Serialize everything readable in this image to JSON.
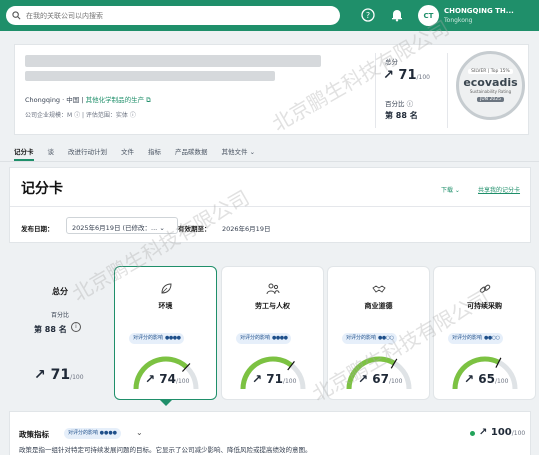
{
  "search": {
    "placeholder": "在我的关联公司以内搜索"
  },
  "account": {
    "initials": "CT",
    "name": "CHONGQING TH...",
    "sub": "Tongkong"
  },
  "profile": {
    "location": "Chongqing · 中国 |",
    "industry_link": "其他化学制品的生产",
    "meta": "公司企业规模：M ⓘ | 评估范围：实体 ⓘ",
    "total_label": "总分",
    "score": "71",
    "score_den": "/100",
    "percentile_label": "百分比",
    "rank": "第 88 名"
  },
  "medal": {
    "level": "SILVER | Top 15%",
    "brand": "ecovadis",
    "tagline": "Sustainability Rating",
    "date": "JUN 2025"
  },
  "tabs": [
    {
      "label": "记分卡"
    },
    {
      "label": "谈"
    },
    {
      "label": "改进行动计划"
    },
    {
      "label": "文件"
    },
    {
      "label": "指标"
    },
    {
      "label": "产品碳数据"
    },
    {
      "label": "其他文件 ⌄"
    }
  ],
  "scorecard": {
    "title": "记分卡",
    "download": "下载 ⌄",
    "share": "共享我的记分卡",
    "publish_label": "发布日期：",
    "publish_value": "2025年6月19日 (已修改：... ⌄",
    "expiry_label": "有效期至：",
    "expiry_value": "2026年6月19日"
  },
  "overall": {
    "label": "总分",
    "percentile_label": "百分比",
    "rank": "第 88 名",
    "score": "71",
    "score_den": "/100"
  },
  "themes": [
    {
      "name": "环境",
      "pill": "对评分的影响",
      "dots": "●●●●",
      "score": "74",
      "score_den": "/100",
      "icon": "leaf-icon"
    },
    {
      "name": "劳工与人权",
      "pill": "对评分的影响",
      "dots": "●●●●",
      "score": "71",
      "score_den": "/100",
      "icon": "people-icon"
    },
    {
      "name": "商业道德",
      "pill": "对评分的影响",
      "dots": "●●○○",
      "score": "67",
      "score_den": "/100",
      "icon": "handshake-icon"
    },
    {
      "name": "可持续采购",
      "pill": "对评分的影响",
      "dots": "●●○○",
      "score": "65",
      "score_den": "/100",
      "icon": "link-icon"
    }
  ],
  "theme_values": [
    74,
    71,
    67,
    65
  ],
  "policy": {
    "title": "政策指标",
    "pill": "对评分的影响 ●●●●",
    "score": "100",
    "score_den": "/100",
    "description": "政策是指一组针对特定可持续发展问题的目标。它显示了公司减少影响、降低风险或提高绩效的意图。"
  },
  "watermark": "北京鹏生科技有限公司",
  "colors": {
    "brand_green": "#1f8f6a",
    "gauge_green": "#7cc242",
    "gauge_track": "#dfe3e6",
    "pill_blue": "#e6effa"
  }
}
